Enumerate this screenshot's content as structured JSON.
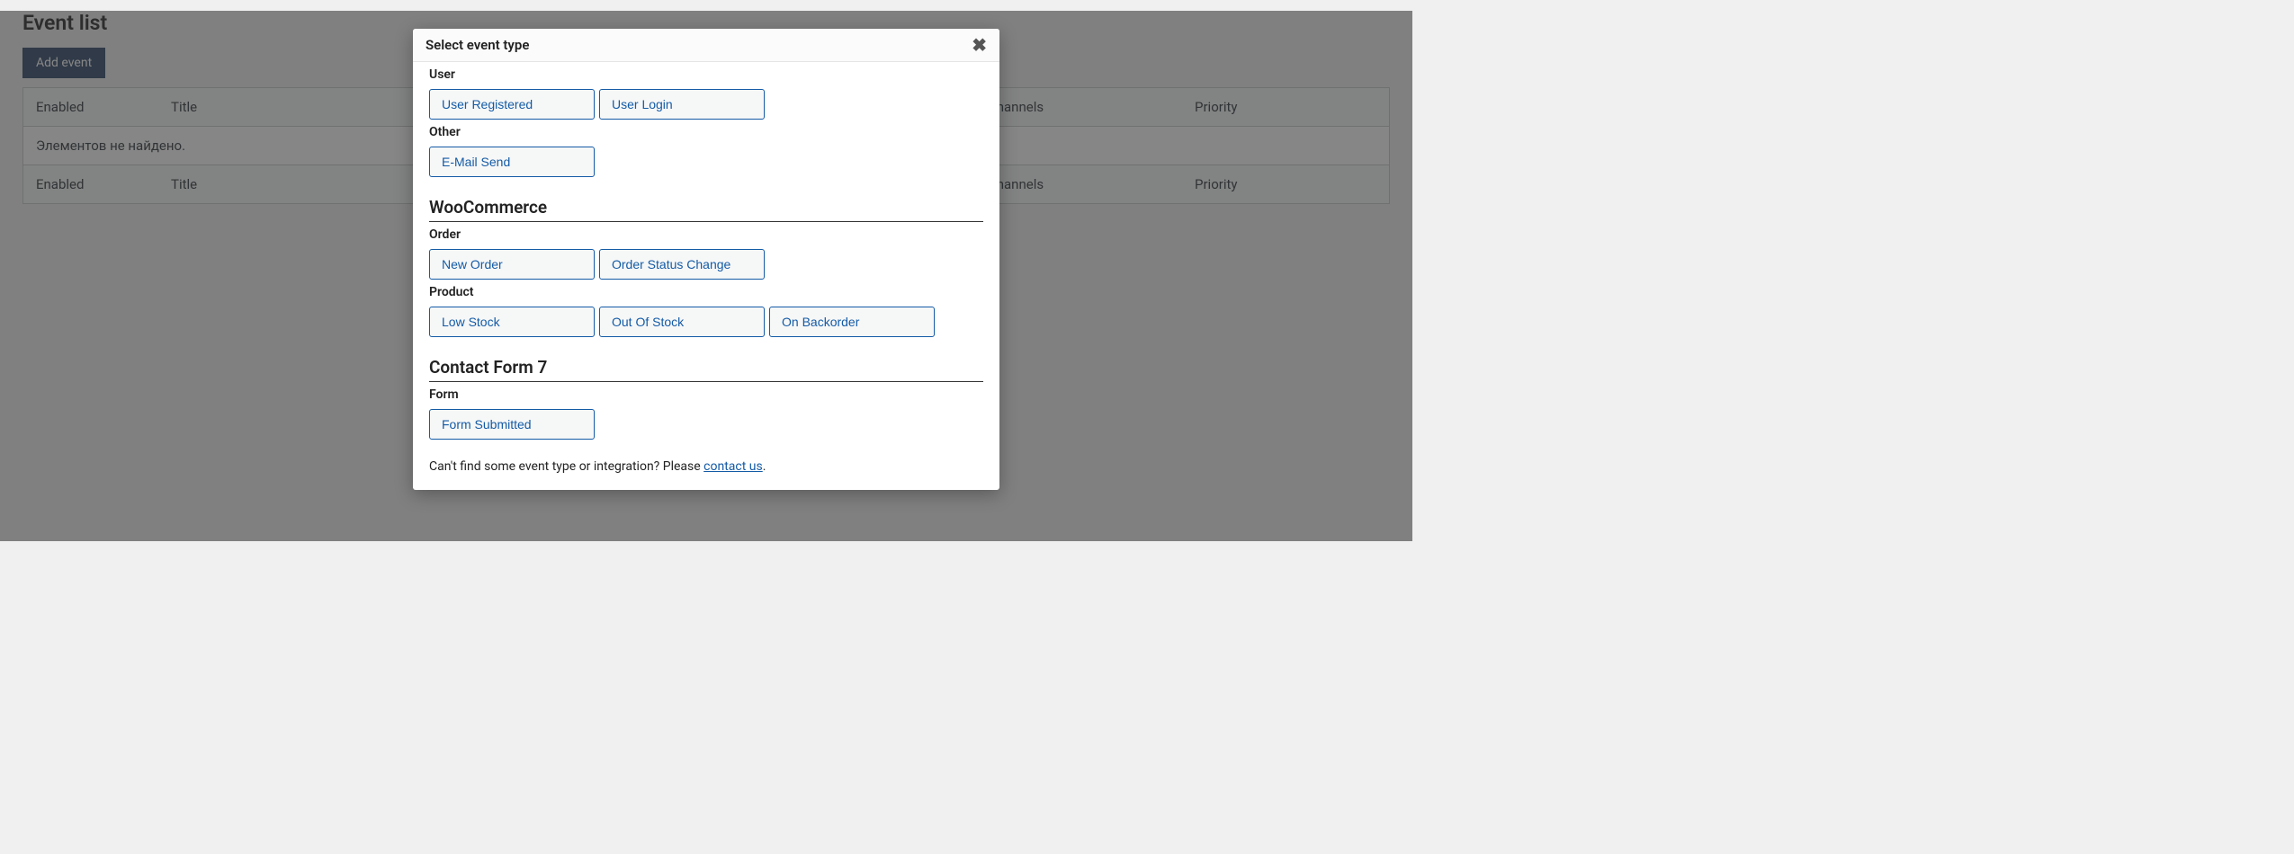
{
  "page": {
    "title": "Event list",
    "add_button": "Add event"
  },
  "table": {
    "headers": {
      "enabled": "Enabled",
      "title": "Title",
      "channels": "Channels",
      "priority": "Priority"
    },
    "empty": "Элементов не найдено."
  },
  "modal": {
    "title": "Select event type",
    "groups": {
      "user": {
        "label": "User",
        "options": {
          "user_registered": "User Registered",
          "user_login": "User Login"
        }
      },
      "other": {
        "label": "Other",
        "options": {
          "email_send": "E-Mail Send"
        }
      },
      "woocommerce": {
        "heading": "WooCommerce",
        "order": {
          "label": "Order",
          "options": {
            "new_order": "New Order",
            "order_status_change": "Order Status Change"
          }
        },
        "product": {
          "label": "Product",
          "options": {
            "low_stock": "Low Stock",
            "out_of_stock": "Out Of Stock",
            "on_backorder": "On Backorder"
          }
        }
      },
      "cf7": {
        "heading": "Contact Form 7",
        "form": {
          "label": "Form",
          "options": {
            "form_submitted": "Form Submitted"
          }
        }
      }
    },
    "footer": {
      "prefix": "Can't find some event type or integration? Please ",
      "link": "contact us",
      "suffix": "."
    }
  }
}
